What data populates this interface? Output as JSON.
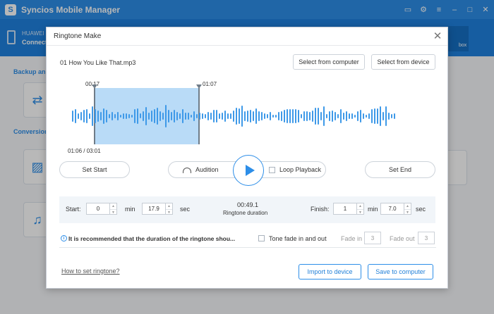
{
  "app": {
    "title": "Syncios Mobile Manager",
    "device_name": "HUAWEI",
    "device_status": "Connect",
    "toolbox_label": "box",
    "section_backup": "Backup an",
    "section_conversion": "Conversion"
  },
  "dialog": {
    "title": "Ringtone Make",
    "close_glyph": "✕",
    "filename": "01 How You Like That.mp3",
    "select_from_computer": "Select from computer",
    "select_from_device": "Select from device"
  },
  "waveform": {
    "start_marker": "00:17",
    "end_marker": "01:07",
    "progress": "01:06 / 03:01",
    "selection_start_fraction": 0.094,
    "selection_end_fraction": 0.37
  },
  "controls": {
    "set_start": "Set Start",
    "audition": "Audition",
    "loop_playback": "Loop Playback",
    "set_end": "Set End"
  },
  "settings": {
    "start_label": "Start:",
    "start_min": "0",
    "min_unit": "min",
    "start_sec": "17.9",
    "sec_unit": "sec",
    "duration_value": "00:49.1",
    "duration_label": "Ringtone duration",
    "finish_label": "Finish:",
    "finish_min": "1",
    "finish_sec": "7.0"
  },
  "tip": {
    "text": "It is recommended that the duration of the ringtone shou...",
    "tone_fade": "Tone fade in and out",
    "fade_in_label": "Fade in",
    "fade_in_value": "3",
    "fade_out_label": "Fade out",
    "fade_out_value": "3"
  },
  "footer": {
    "help_link": "How to set ringtone?",
    "import_button": "Import to device",
    "save_button": "Save to computer"
  },
  "colors": {
    "accent": "#2d8ee8",
    "selection": "#b9dbf7",
    "wave": "#3e99e8"
  }
}
